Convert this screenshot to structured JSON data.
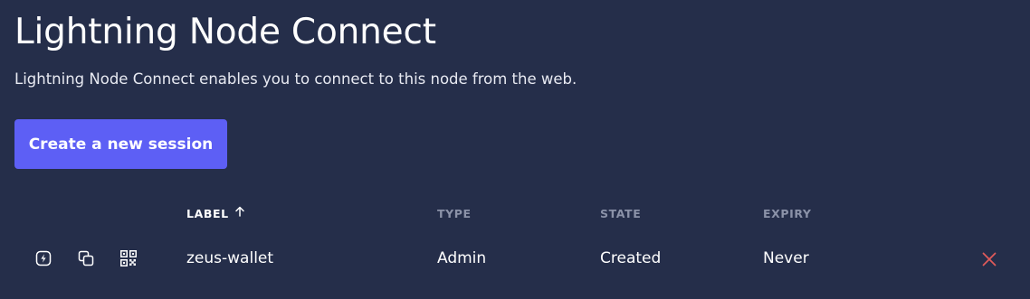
{
  "page": {
    "title": "Lightning Node Connect",
    "subtitle": "Lightning Node Connect enables you to connect to this node from the web."
  },
  "actions": {
    "create_label": "Create a new session"
  },
  "table": {
    "columns": [
      {
        "label": "LABEL",
        "sorted": "ascending"
      },
      {
        "label": "TYPE"
      },
      {
        "label": "STATE"
      },
      {
        "label": "EXPIRY"
      }
    ],
    "rows": [
      {
        "label": "zeus-wallet",
        "type": "Admin",
        "state": "Created",
        "expiry": "Never",
        "icons": [
          "lightning-bolt-icon",
          "copy-icon",
          "qr-code-icon"
        ],
        "delete_icon": "close-icon"
      }
    ]
  },
  "colors": {
    "background": "#252e4a",
    "accent": "#5d5ff5",
    "header_text": "#8b92a8",
    "delete": "#e05a5a"
  }
}
